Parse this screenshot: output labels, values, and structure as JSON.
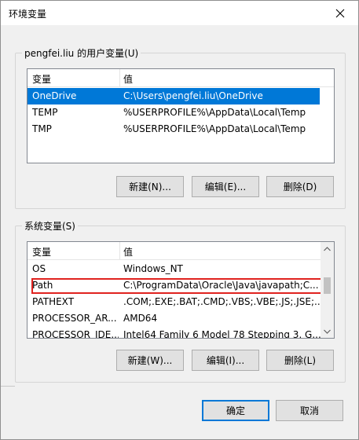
{
  "window": {
    "title": "环境变量",
    "close_icon": "close-icon"
  },
  "user_vars": {
    "group_label": "pengfei.liu 的用户变量(U)",
    "columns": [
      "变量",
      "值"
    ],
    "rows": [
      {
        "name": "OneDrive",
        "value": "C:\\Users\\pengfei.liu\\OneDrive",
        "selected": true
      },
      {
        "name": "TEMP",
        "value": "%USERPROFILE%\\AppData\\Local\\Temp"
      },
      {
        "name": "TMP",
        "value": "%USERPROFILE%\\AppData\\Local\\Temp"
      }
    ],
    "buttons": {
      "new": "新建(N)...",
      "edit": "编辑(E)...",
      "delete": "删除(D)"
    }
  },
  "system_vars": {
    "group_label": "系统变量(S)",
    "columns": [
      "变量",
      "值"
    ],
    "rows": [
      {
        "name": "OS",
        "value": "Windows_NT"
      },
      {
        "name": "Path",
        "value": "C:\\ProgramData\\Oracle\\Java\\javapath;C...",
        "highlighted": true
      },
      {
        "name": "PATHEXT",
        "value": ".COM;.EXE;.BAT;.CMD;.VBS;.VBE;.JS;.JSE;...."
      },
      {
        "name": "PROCESSOR_AR...",
        "value": "AMD64"
      },
      {
        "name": "PROCESSOR_IDE...",
        "value": "Intel64 Family 6 Model 78 Stepping 3, G..."
      }
    ],
    "buttons": {
      "new": "新建(W)...",
      "edit": "编辑(I)...",
      "delete": "删除(L)"
    }
  },
  "footer": {
    "ok": "确定",
    "cancel": "取消"
  },
  "colors": {
    "selection": "#0078d7",
    "highlight_box": "#e0231f",
    "default_button_border": "#0078d7"
  }
}
